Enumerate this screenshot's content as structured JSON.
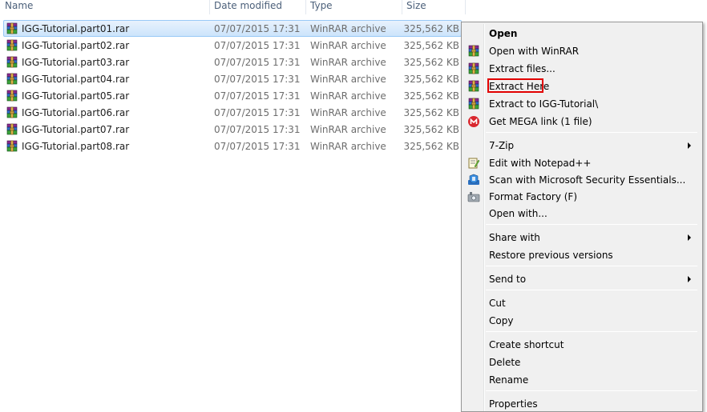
{
  "columns": {
    "name": "Name",
    "date": "Date modified",
    "type": "Type",
    "size": "Size"
  },
  "files": [
    {
      "name": "IGG-Tutorial.part01.rar",
      "date": "07/07/2015 17:31",
      "type": "WinRAR archive",
      "size": "325,562 KB",
      "selected": true
    },
    {
      "name": "IGG-Tutorial.part02.rar",
      "date": "07/07/2015 17:31",
      "type": "WinRAR archive",
      "size": "325,562 KB"
    },
    {
      "name": "IGG-Tutorial.part03.rar",
      "date": "07/07/2015 17:31",
      "type": "WinRAR archive",
      "size": "325,562 KB"
    },
    {
      "name": "IGG-Tutorial.part04.rar",
      "date": "07/07/2015 17:31",
      "type": "WinRAR archive",
      "size": "325,562 KB"
    },
    {
      "name": "IGG-Tutorial.part05.rar",
      "date": "07/07/2015 17:31",
      "type": "WinRAR archive",
      "size": "325,562 KB"
    },
    {
      "name": "IGG-Tutorial.part06.rar",
      "date": "07/07/2015 17:31",
      "type": "WinRAR archive",
      "size": "325,562 KB"
    },
    {
      "name": "IGG-Tutorial.part07.rar",
      "date": "07/07/2015 17:31",
      "type": "WinRAR archive",
      "size": "325,562 KB"
    },
    {
      "name": "IGG-Tutorial.part08.rar",
      "date": "07/07/2015 17:31",
      "type": "WinRAR archive",
      "size": "325,562 KB"
    }
  ],
  "context_menu": {
    "items": [
      {
        "label": "Open",
        "bold": true,
        "icon": "none"
      },
      {
        "label": "Open with WinRAR",
        "icon": "winrar-icon"
      },
      {
        "label": "Extract files...",
        "icon": "winrar-icon"
      },
      {
        "label": "Extract Here",
        "icon": "winrar-icon",
        "highlighted": true
      },
      {
        "label": "Extract to IGG-Tutorial\\",
        "icon": "winrar-icon"
      },
      {
        "label": "Get MEGA link (1 file)",
        "icon": "mega-icon"
      },
      {
        "label": "7-Zip",
        "icon": "none",
        "submenu": true
      },
      {
        "label": "Edit with Notepad++",
        "icon": "notepad-plus-plus-icon"
      },
      {
        "label": "Scan with Microsoft Security Essentials...",
        "icon": "security-essentials-icon"
      },
      {
        "label": "Format Factory (F)",
        "icon": "format-factory-icon"
      },
      {
        "label": "Open with...",
        "icon": "none"
      },
      {
        "label": "Share with",
        "icon": "none",
        "submenu": true
      },
      {
        "label": "Restore previous versions",
        "icon": "none"
      },
      {
        "label": "Send to",
        "icon": "none",
        "submenu": true
      },
      {
        "label": "Cut",
        "icon": "none"
      },
      {
        "label": "Copy",
        "icon": "none"
      },
      {
        "label": "Create shortcut",
        "icon": "none"
      },
      {
        "label": "Delete",
        "icon": "none"
      },
      {
        "label": "Rename",
        "icon": "none"
      },
      {
        "label": "Properties",
        "icon": "none"
      }
    ]
  },
  "colors": {
    "selection": "#cce4fb",
    "highlight_border": "#e20000",
    "mega_red": "#d9272e"
  }
}
